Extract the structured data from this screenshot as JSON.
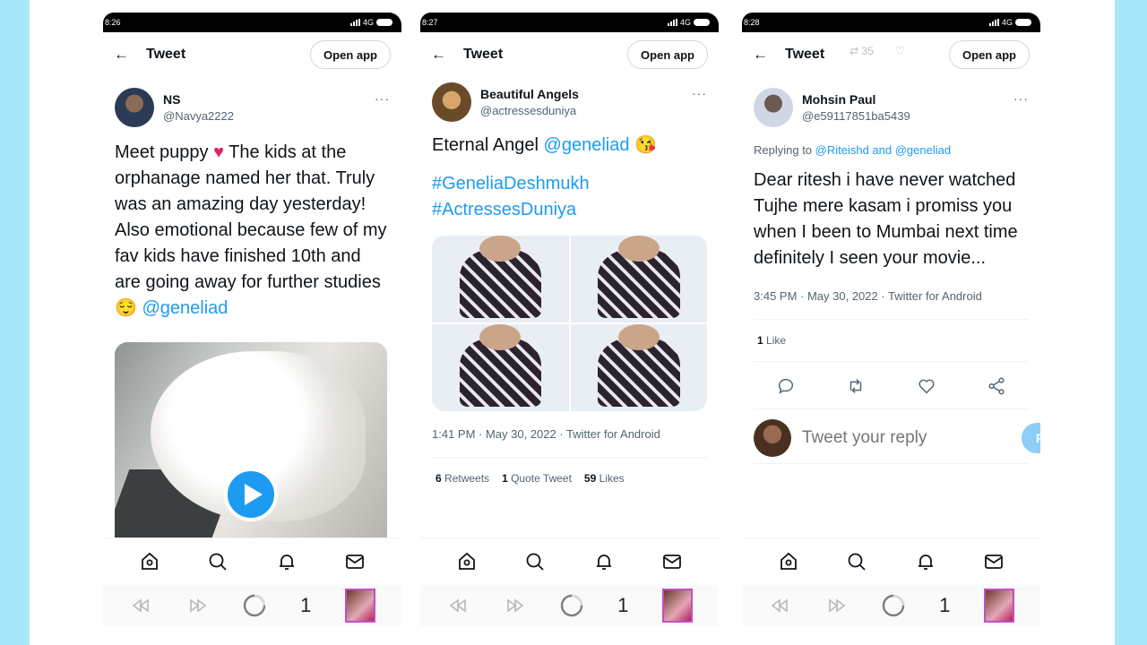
{
  "common": {
    "topbar_title": "Tweet",
    "open_app": "Open app",
    "more": "···",
    "tab_count": "1"
  },
  "phone1": {
    "time": "8:26",
    "network": "4G",
    "author_name": "NS",
    "author_handle": "@Navya2222",
    "text_1": "Meet puppy ",
    "heart": "♥",
    "text_2": " The kids at the orphanage named her that. Truly was an amazing day yesterday! Also emotional because few of my fav kids have finished 10th and are going away for further studies ",
    "emoji": "😌",
    "mention": "@geneliad"
  },
  "phone2": {
    "time": "8:27",
    "network": "4G",
    "author_name": "Beautiful Angels",
    "author_handle": "@actressesduniya",
    "text_1": "Eternal Angel ",
    "mention": "@geneliad",
    "emoji": "😘",
    "hashtag_1": "#GeneliaDeshmukh",
    "hashtag_2": "#ActressesDuniya",
    "meta": "1:41 PM · May 30, 2022 · Twitter for Android",
    "retweets_count": "6",
    "retweets_label": "Retweets",
    "quote_count": "1",
    "quote_label": "Quote Tweet",
    "likes_count": "59",
    "likes_label": "Likes"
  },
  "phone3": {
    "time": "8:28",
    "network": "4G",
    "ghost_count_1": "35",
    "author_name": "Mohsin Paul",
    "author_handle": "@e59117851ba5439",
    "replying_prefix": "Replying to ",
    "replying_to": "@Riteishd and @geneliad",
    "text": "Dear ritesh i have never watched Tujhe mere kasam i promiss you when I been to Mumbai next time definitely I seen your movie...",
    "meta": "3:45 PM · May 30, 2022 · Twitter for Android",
    "likes_count": "1",
    "likes_label": "Like",
    "reply_placeholder": "Tweet your reply",
    "reply_button": "Reply"
  }
}
